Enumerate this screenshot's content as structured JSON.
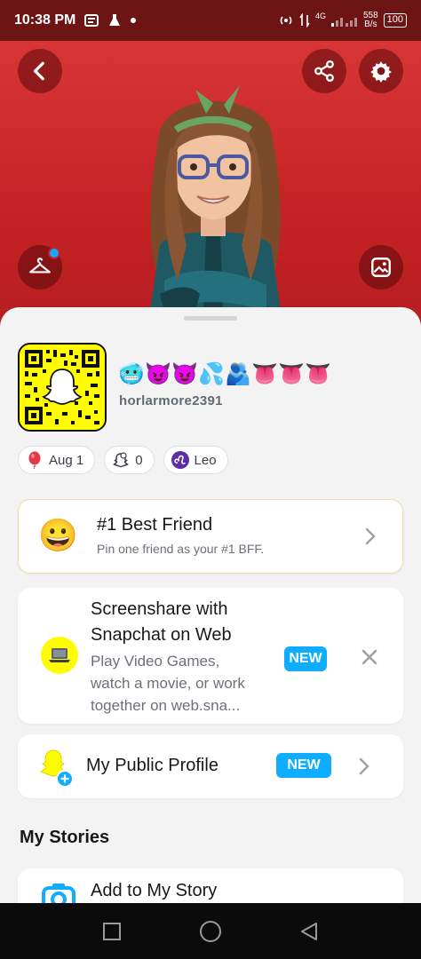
{
  "status": {
    "time": "10:38 PM",
    "network": "4G",
    "speed_top": "558",
    "speed_bottom": "B/s",
    "battery": "100"
  },
  "header": {
    "back_icon": "chevron-left-icon",
    "share_icon": "share-icon",
    "settings_icon": "gear-icon",
    "wardrobe_icon": "hanger-icon",
    "gallery_icon": "image-icon",
    "accent": "#c42224"
  },
  "profile": {
    "emojis": [
      "🥶",
      "😈",
      "😈",
      "💦",
      "🫂",
      "👅",
      "👅",
      "👅"
    ],
    "username": "horlarmore2391",
    "chips": [
      {
        "icon": "balloon-icon",
        "label": "Aug 1"
      },
      {
        "icon": "ghost-friends-icon",
        "label": "0"
      },
      {
        "icon": "leo-zodiac-icon",
        "label": "Leo"
      }
    ]
  },
  "best_friend": {
    "emoji": "😀",
    "title": "#1 Best Friend",
    "subtitle": "Pin one friend as your #1 BFF."
  },
  "screenshare": {
    "title_line1": "Screenshare with",
    "title_line2": "Snapchat on Web",
    "desc_line1": "Play Video Games,",
    "desc_line2": "watch a movie, or work",
    "desc_line3": "together on web.sna...",
    "badge": "NEW"
  },
  "public_profile": {
    "title": "My Public Profile",
    "badge": "NEW"
  },
  "stories": {
    "section_title": "My Stories",
    "add_label": "Add to My Story"
  },
  "colors": {
    "snap_yellow": "#fffc00",
    "new_blue": "#0eadff",
    "header_red": "#c42224"
  }
}
